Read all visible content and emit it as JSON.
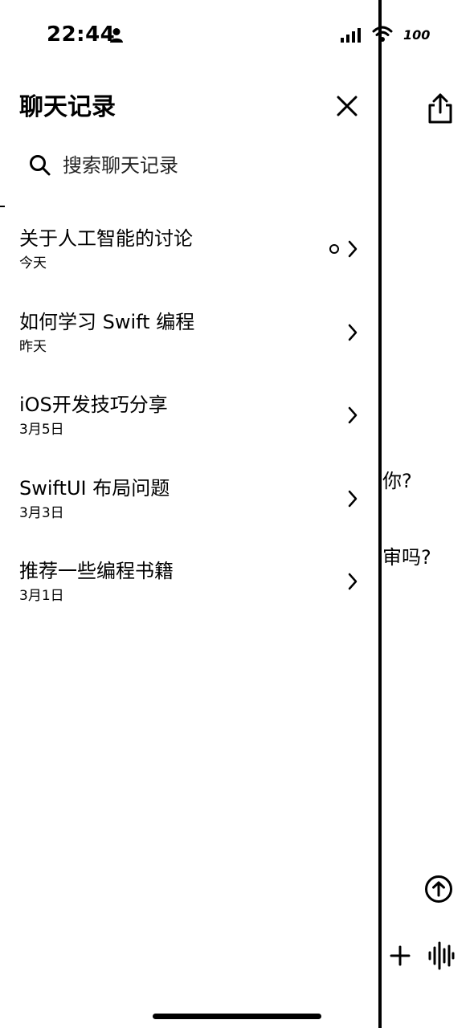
{
  "status_bar": {
    "time": "22:44",
    "battery": "100",
    "icons": [
      "person-icon",
      "signal-icon",
      "wifi-icon"
    ]
  },
  "panel": {
    "title": "聊天记录",
    "close_icon": "close-icon"
  },
  "search": {
    "placeholder": "搜索聊天记录",
    "value": ""
  },
  "chats": [
    {
      "title": "关于人工智能的讨论",
      "date": "今天",
      "active": true
    },
    {
      "title": "如何学习 Swift 编程",
      "date": "昨天",
      "active": false
    },
    {
      "title": "iOS开发技巧分享",
      "date": "3月5日",
      "active": false
    },
    {
      "title": "SwiftUI 布局问题",
      "date": "3月3日",
      "active": false
    },
    {
      "title": "推荐一些编程书籍",
      "date": "3月1日",
      "active": false
    }
  ],
  "background_chat": {
    "peek_line_1": "你?",
    "peek_line_2": "审吗?",
    "icons": [
      "share-icon",
      "scroll-down-icon",
      "plus-icon",
      "voice-waveform-icon"
    ]
  },
  "colors": {
    "foreground": "#000000",
    "background": "#ffffff"
  }
}
